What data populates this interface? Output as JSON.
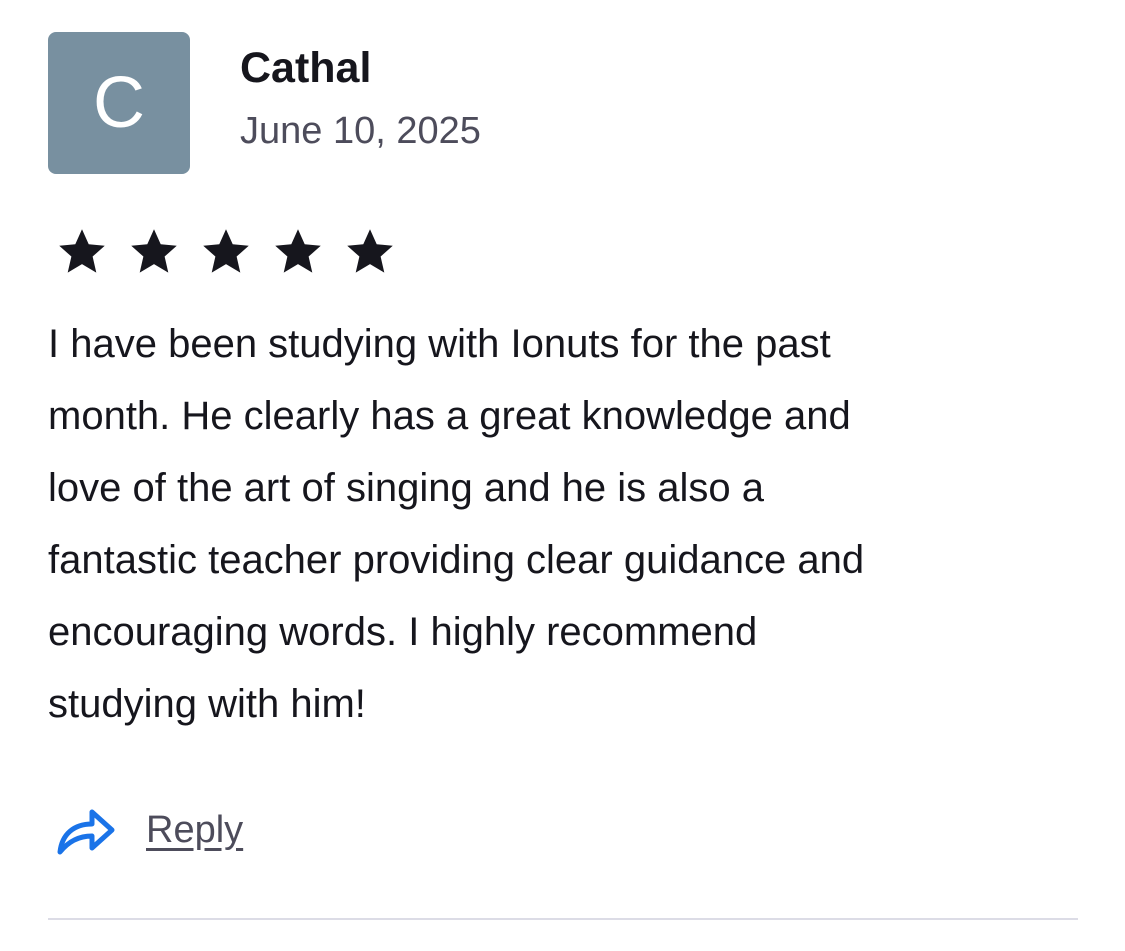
{
  "review": {
    "avatar_initial": "C",
    "author": "Cathal",
    "date": "June 10, 2025",
    "rating": 5,
    "rating_max": 5,
    "body_lines": [
      "I have been studying with Ionuts for the past",
      "month. He clearly has a great knowledge and",
      "love of the art of singing and he is also a",
      "fantastic teacher providing clear guidance and",
      "encouraging words. I highly recommend",
      "studying with him!"
    ],
    "reply_label": "Reply"
  },
  "icons": {
    "star": "star-icon",
    "reply": "reply-arrow-icon"
  },
  "colors": {
    "avatar_bg": "#7890a0",
    "text": "#16161d",
    "muted": "#4d4c5b",
    "accent_blue": "#1a73e8",
    "divider": "#dcdce6"
  }
}
